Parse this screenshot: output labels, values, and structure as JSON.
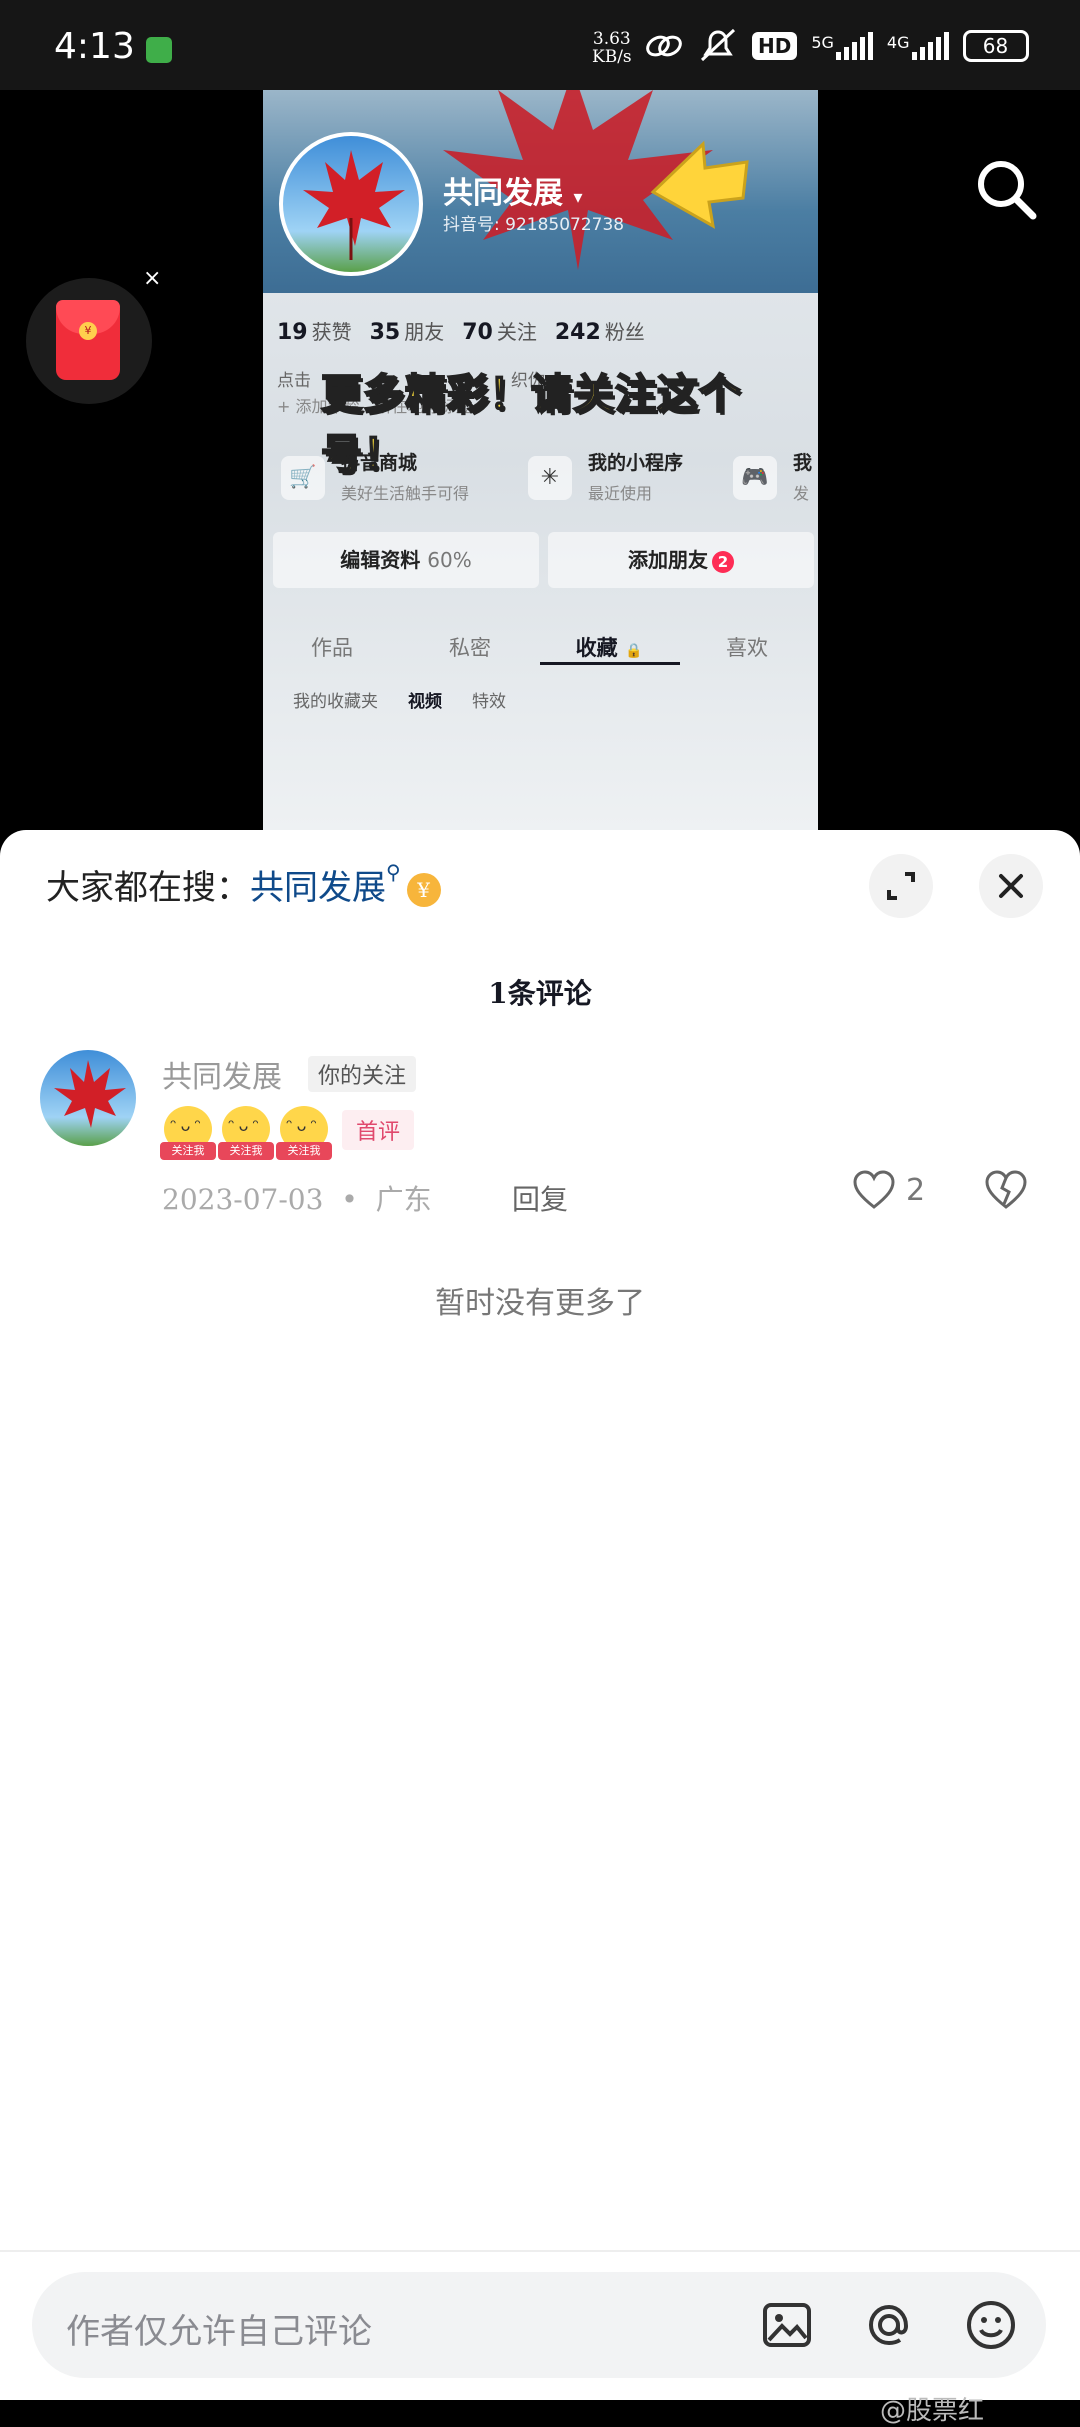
{
  "status_bar": {
    "time": "4:13",
    "speed_value": "3.63",
    "speed_unit": "KB/s",
    "hd_label": "HD",
    "net1": "5G",
    "net2": "4G",
    "battery": "68"
  },
  "video": {
    "profile_name": "共同发展",
    "profile_id": "抖音号: 92185072738",
    "stats": [
      {
        "num": "19",
        "label": "获赞"
      },
      {
        "num": "35",
        "label": "朋友"
      },
      {
        "num": "70",
        "label": "关注"
      },
      {
        "num": "242",
        "label": "粉丝"
      }
    ],
    "hint": "点击",
    "hint_tail": "织你",
    "hint2": "+ 添加年龄、所在地等标签",
    "banner": "更多精彩！请关注这个号！",
    "tools": [
      {
        "title": "抖音商城",
        "sub": "美好生活触手可得",
        "icon": "cart-icon"
      },
      {
        "title": "我的小程序",
        "sub": "最近使用",
        "icon": "miniapp-icon"
      },
      {
        "title": "我",
        "sub": "发",
        "icon": "game-icon"
      }
    ],
    "edit_profile": "编辑资料",
    "edit_pct": "60%",
    "add_friends": "添加朋友",
    "add_friends_badge": "2",
    "tabs": [
      "作品",
      "私密",
      "收藏",
      "喜欢"
    ],
    "subtabs": [
      "我的收藏夹",
      "视频",
      "特效"
    ]
  },
  "redpacket": {
    "close": "×",
    "coin": "¥"
  },
  "sheet": {
    "trend_prefix": "大家都在搜：",
    "trend_keyword": "共同发展",
    "comment_count": "1条评论",
    "comment": {
      "author": "共同发展",
      "tag": "你的关注",
      "emoji_label": "关注我",
      "first_badge": "首评",
      "date": "2023-07-03",
      "location": "广东",
      "reply": "回复",
      "likes": "2"
    },
    "no_more": "暂时没有更多了",
    "input_placeholder": "作者仅允许自己评论",
    "watermark": "@股票红"
  }
}
